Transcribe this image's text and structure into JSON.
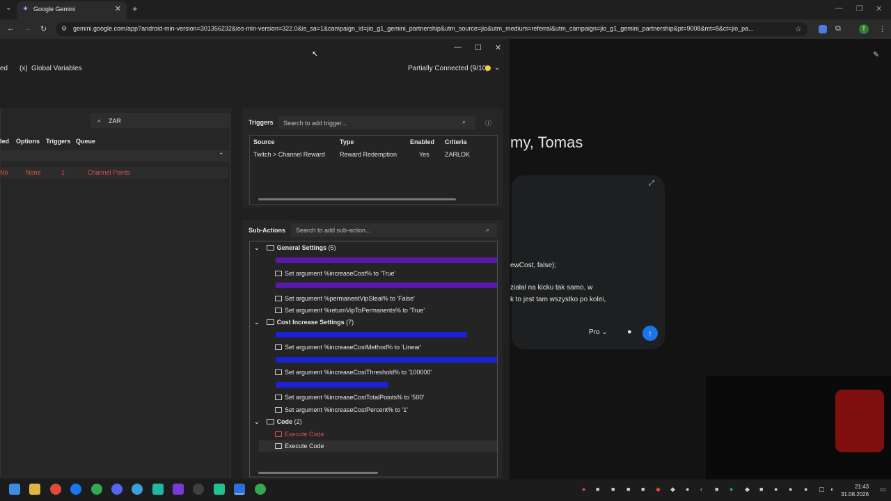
{
  "browser": {
    "tab_title": "Google Gemini",
    "url": "gemini.google.com/app?android-min-version=301356232&ios-min-version=322.0&is_sa=1&campaign_id=jio_g1_gemini_partnership&utm_source=jio&utm_medium=referral&utm_campaign=jio_g1_gemini_partnership&pt=9008&mt=8&ct=jio_pa...",
    "profile_initial": "T"
  },
  "gemini": {
    "greeting": "my, Tomas",
    "code_line_1": "ewCost, false);",
    "text_line_1": "ziałał na kicku tak samo, w",
    "text_line_2": "k to jest tam wszystko po kolei,",
    "model_label": "Pro"
  },
  "sb": {
    "menu_left": "ed",
    "global_variables": "Global Variables",
    "connection_status": "Partially Connected (9/10)",
    "search_value": "ZAR",
    "left_headers": {
      "enabled": "led",
      "options": "Options",
      "triggers": "Triggers",
      "queue": "Queue"
    },
    "left_row": {
      "enabled": "No",
      "options": "None",
      "triggers": "1",
      "queue": "Channel Points"
    },
    "triggers": {
      "title": "Triggers",
      "search_placeholder": "Search to add trigger...",
      "headers": {
        "source": "Source",
        "type": "Type",
        "enabled": "Enabled",
        "criteria": "Criteria"
      },
      "rows": [
        {
          "source": "Twitch > Channel Reward",
          "type": "Reward Redemption",
          "enabled": "Yes",
          "criteria": "ZARŁOK"
        }
      ]
    },
    "subactions": {
      "title": "Sub-Actions",
      "search_placeholder": "Search to add sub-action...",
      "groups": {
        "general": "General Settings",
        "general_count": "(5)",
        "cost": "Cost Increase Settings",
        "cost_count": "(7)",
        "code": "Code",
        "code_count": "(2)"
      },
      "items": {
        "g1": "Set argument %increaseCost% to 'True'",
        "g2": "Set argument %permanentVipSteal% to 'False'",
        "g3": "Set argument %returnVipToPermanents% to 'True'",
        "c1": "Set argument %increaseCostMethod% to 'Linear'",
        "c2": "Set argument %increaseCostThreshold% to '100000'",
        "c3": "Set argument %increaseCostTotalPoints% to '500'",
        "c4": "Set argument %increaseCostPercent% to '1'",
        "code1": "Execute Code",
        "code2": "Execute Code"
      }
    }
  },
  "taskbar": {
    "time": "21:43",
    "date": "31.08.2026"
  },
  "colors": {
    "comment_purple": "#7b1fd4",
    "comment_blue": "#1a22d8",
    "disabled_red": "#d9534f",
    "status_yellow": "#f4d03f"
  }
}
